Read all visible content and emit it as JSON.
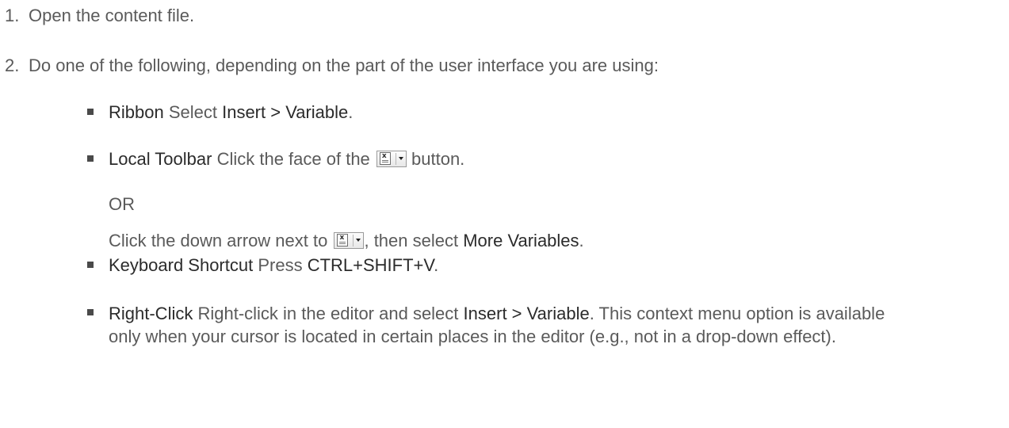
{
  "steps": [
    {
      "number": "1.",
      "text": "Open the content file."
    },
    {
      "number": "2.",
      "text": "Do one of the following, depending on the part of the user interface you are using:"
    }
  ],
  "options": {
    "ribbon": {
      "label": "Ribbon",
      "text_1": " Select ",
      "command": "Insert > Variable",
      "text_2": "."
    },
    "local_toolbar": {
      "label": "Local Toolbar",
      "text_1": " Click the face of the ",
      "text_2": " button.",
      "or": "OR",
      "alt_text_1": "Click the down arrow next to ",
      "alt_text_2": ", then select ",
      "alt_command": "More Variables",
      "alt_text_3": ".",
      "icon": "insert-variable-toolbar-icon"
    },
    "keyboard": {
      "label": "Keyboard Shortcut",
      "text_1": " Press ",
      "shortcut": "CTRL+SHIFT+V",
      "text_2": "."
    },
    "right_click": {
      "label": "Right-Click",
      "text_1": " Right-click in the editor and select ",
      "command": "Insert > Variable",
      "text_2": ". This context menu option is available only when your cursor is located in certain places in the editor (e.g., not in a drop-down effect)."
    }
  }
}
